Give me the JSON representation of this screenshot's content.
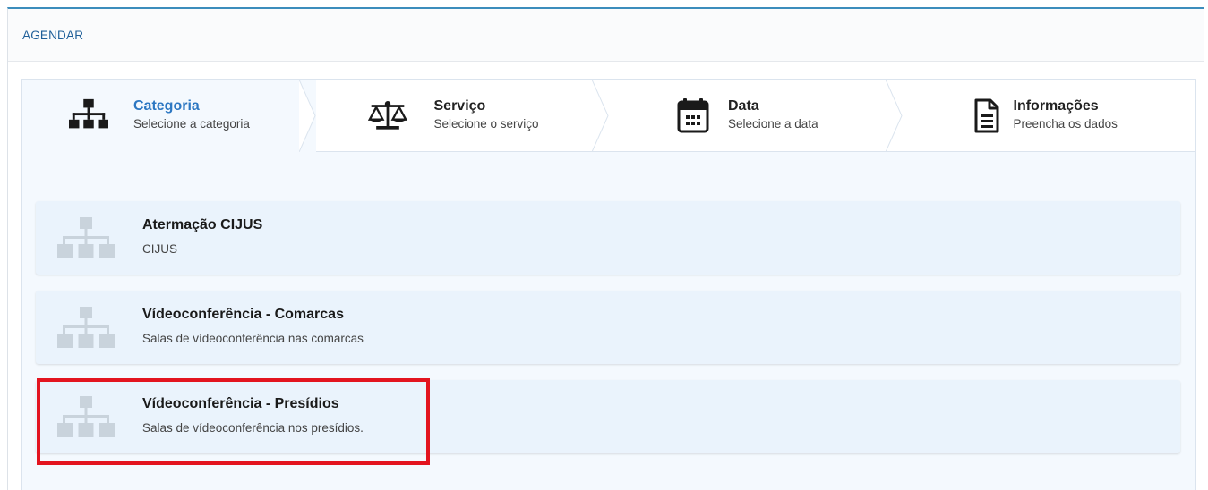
{
  "panel": {
    "title": "AGENDAR"
  },
  "steps": [
    {
      "title": "Categoria",
      "subtitle": "Selecione a categoria",
      "icon": "sitemap-icon",
      "active": true
    },
    {
      "title": "Serviço",
      "subtitle": "Selecione o serviço",
      "icon": "balance-scale-icon",
      "active": false
    },
    {
      "title": "Data",
      "subtitle": "Selecione a data",
      "icon": "calendar-icon",
      "active": false
    },
    {
      "title": "Informações",
      "subtitle": "Preencha os dados",
      "icon": "file-text-icon",
      "active": false
    }
  ],
  "categories": [
    {
      "title": "Atermação CIJUS",
      "subtitle": "CIJUS",
      "icon": "sitemap-icon"
    },
    {
      "title": "Vídeoconferência - Comarcas",
      "subtitle": "Salas de vídeoconferência nas comarcas",
      "icon": "sitemap-icon"
    },
    {
      "title": "Vídeoconferência - Presídios",
      "subtitle": "Salas de vídeoconferência nos presídios.",
      "icon": "sitemap-icon"
    }
  ],
  "colors": {
    "accent": "#2c77c2",
    "header_border": "#3c8dbc",
    "card_bg": "#eaf3fc",
    "highlight": "#e3141f"
  }
}
